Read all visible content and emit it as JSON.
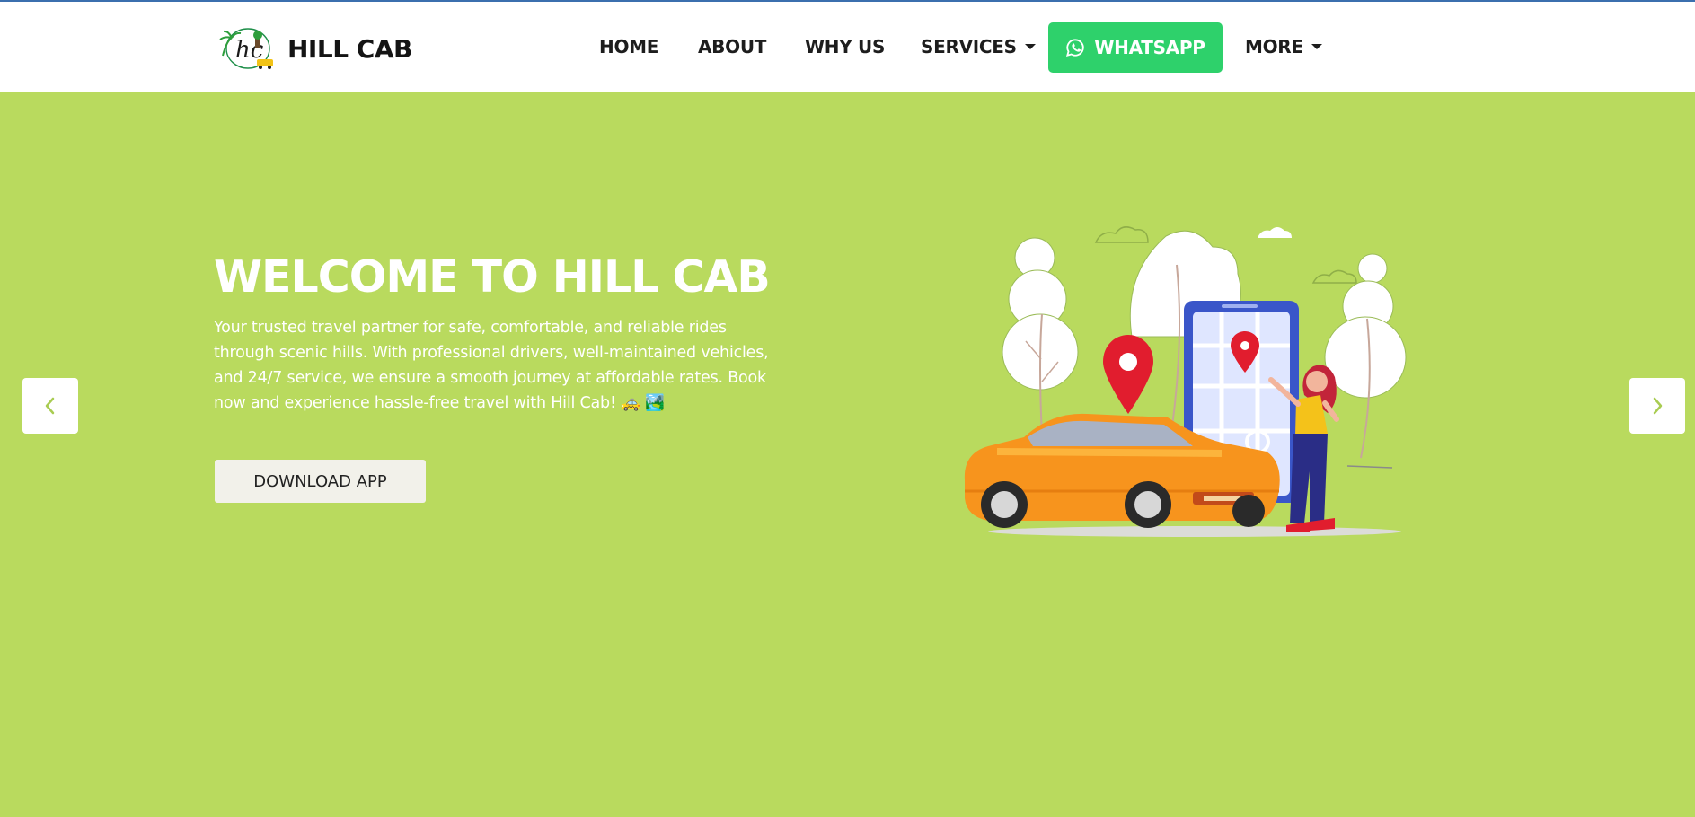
{
  "brand": {
    "name": "HILL CAB",
    "logo_icon": "hill-cab-logo"
  },
  "nav": {
    "home": "HOME",
    "about": "ABOUT",
    "why_us": "WHY US",
    "services": "SERVICES",
    "whatsapp": "WHATSAPP",
    "more": "MORE"
  },
  "hero": {
    "title": "WELCOME TO HILL CAB",
    "text": "Your trusted travel partner for safe, comfortable, and reliable rides through scenic hills. With professional drivers, well-maintained vehicles, and 24/7 service, we ensure a smooth journey at affordable rates. Book now and experience hassle-free travel with Hill Cab! 🚕 🏞️",
    "download_label": "DOWNLOAD APP"
  },
  "carousel": {
    "prev_icon": "chevron-left-icon",
    "next_icon": "chevron-right-icon"
  },
  "colors": {
    "hero_background": "#b9da5e",
    "whatsapp_green": "#2ed16b",
    "top_border": "#3b6fae",
    "car_orange": "#f7941d",
    "pin_red": "#e11d2e"
  }
}
